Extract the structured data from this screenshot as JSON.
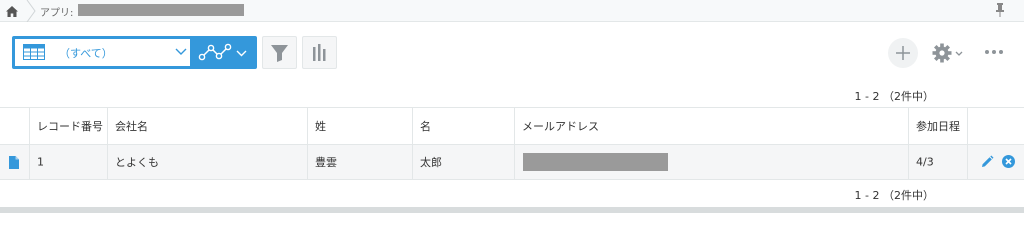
{
  "breadcrumb": {
    "app_label": "アプリ:",
    "app_name": "[redacted]"
  },
  "view_selector": {
    "selected": "（すべて）"
  },
  "pagination": {
    "text": "1 - 2 （2件中）"
  },
  "table": {
    "headers": [
      "レコード番号",
      "会社名",
      "姓",
      "名",
      "メールアドレス",
      "参加日程"
    ],
    "rows": [
      {
        "record_no": "1",
        "company": "とよくも",
        "last_name": "豊雲",
        "first_name": "太郎",
        "email": "[redacted]",
        "date": "4/3"
      }
    ]
  },
  "colors": {
    "accent": "#3498db",
    "icon_gray": "#8e9499",
    "border": "#e3e7e8"
  },
  "icons": {
    "home": "home-icon",
    "pin": "pin-icon",
    "grid": "table-view-icon",
    "graph": "graph-icon",
    "filter": "filter-icon",
    "chart": "bar-chart-icon",
    "add": "plus-icon",
    "settings": "gear-icon",
    "more": "more-icon",
    "detail": "document-icon",
    "edit": "pencil-icon",
    "delete": "delete-icon"
  }
}
